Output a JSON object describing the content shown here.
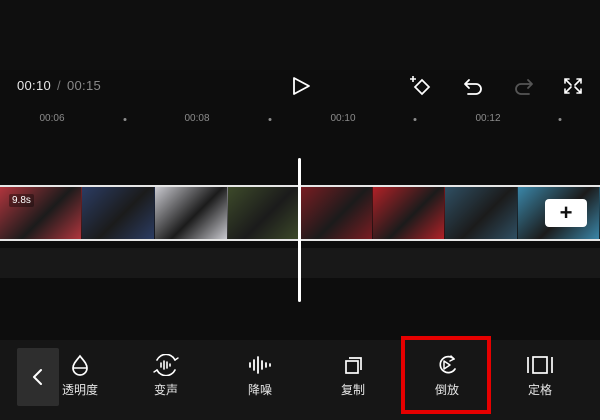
{
  "player": {
    "current_time": "00:10",
    "separator": "/",
    "total_time": "00:15",
    "controls": [
      {
        "icon": "play-icon"
      },
      {
        "icon": "add-keyframe-icon"
      },
      {
        "icon": "undo-icon"
      },
      {
        "icon": "redo-icon",
        "enabled": false
      },
      {
        "icon": "fullscreen-icon"
      }
    ]
  },
  "timeline": {
    "ruler": [
      "00:06",
      "00:08",
      "00:10",
      "00:12"
    ],
    "clip_duration": "9.8s",
    "add_clip_label": "+",
    "thumbnail_colors": [
      "#b0353d",
      "#2b3c63",
      "#c9c9cf",
      "#3d4a2a",
      "#7a1c22",
      "#b12127",
      "#2f4f63",
      "#3a86a8"
    ]
  },
  "toolbar": {
    "back_icon": "chevron-left-icon",
    "tools": [
      {
        "icon": "opacity-icon",
        "label": "透明度"
      },
      {
        "icon": "voice-change-icon",
        "label": "变声"
      },
      {
        "icon": "noise-reduction-icon",
        "label": "降噪"
      },
      {
        "icon": "copy-icon",
        "label": "复制"
      },
      {
        "icon": "reverse-icon",
        "label": "倒放",
        "highlighted": true
      },
      {
        "icon": "freeze-frame-icon",
        "label": "定格"
      }
    ]
  },
  "colors": {
    "background": "#0d0d0d",
    "highlight": "#e60000",
    "clip_border": "#e6e6e6"
  }
}
